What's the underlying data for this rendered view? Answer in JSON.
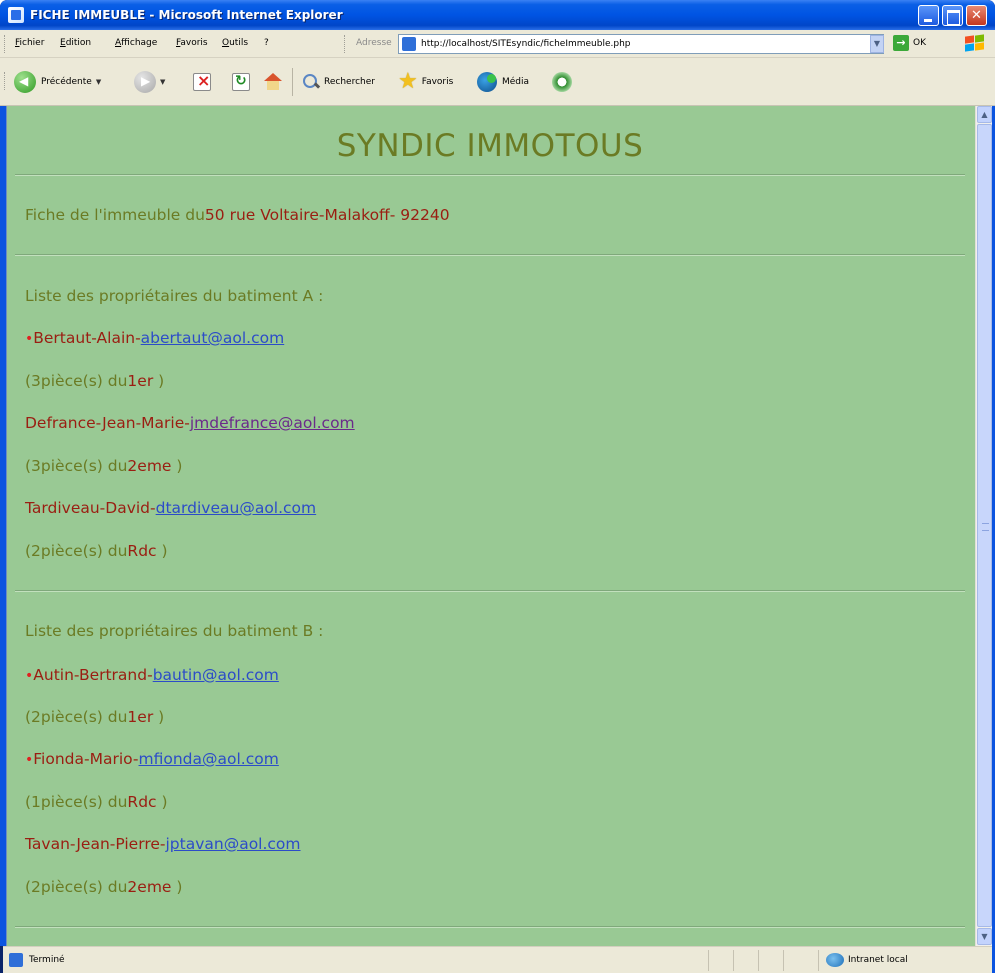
{
  "window": {
    "title": "FICHE IMMEUBLE - Microsoft Internet Explorer"
  },
  "menu": {
    "items": [
      "Fichier",
      "Edition",
      "Affichage",
      "Favoris",
      "Outils",
      "?"
    ],
    "address_label": "Adresse",
    "address_url": "http://localhost/SITEsyndic/ficheImmeuble.php",
    "go_label": "OK"
  },
  "toolbar": {
    "back_label": "Précédente",
    "search_label": "Rechercher",
    "favorites_label": "Favoris",
    "media_label": "Média"
  },
  "page": {
    "site_title": "SYNDIC IMMOTOUS",
    "fiche_prefix": "Fiche de l'immeuble du",
    "fiche_address": "50 rue Voltaire-Malakoff- 92240",
    "buildings": [
      {
        "heading": "Liste des propriétaires du batiment A :",
        "owners": [
          {
            "bullet": "•",
            "name": "Bertaut-Alain-",
            "email": "abertaut@aol.com",
            "pieces_open": "(3pièce(s) du",
            "floor": "1er",
            "pieces_close": " )"
          },
          {
            "bullet": "",
            "name": "Defrance-Jean-Marie-",
            "email": "jmdefrance@aol.com",
            "pieces_open": "(3pièce(s) du",
            "floor": "2eme",
            "pieces_close": " )"
          },
          {
            "bullet": "",
            "name": "Tardiveau-David-",
            "email": "dtardiveau@aol.com",
            "pieces_open": "(2pièce(s) du",
            "floor": "Rdc",
            "pieces_close": " )"
          }
        ]
      },
      {
        "heading": "Liste des propriétaires du batiment B :",
        "owners": [
          {
            "bullet": "•",
            "name": "Autin-Bertrand-",
            "email": "bautin@aol.com",
            "pieces_open": "(2pièce(s) du",
            "floor": "1er",
            "pieces_close": " )"
          },
          {
            "bullet": "•",
            "name": "Fionda-Mario-",
            "email": "mfionda@aol.com",
            "pieces_open": "(1pièce(s) du",
            "floor": "Rdc",
            "pieces_close": " )"
          },
          {
            "bullet": "",
            "name": "Tavan-Jean-Pierre-",
            "email": "jptavan@aol.com",
            "pieces_open": "(2pièce(s) du",
            "floor": "2eme",
            "pieces_close": " )"
          }
        ]
      }
    ]
  },
  "status": {
    "text": "Terminé",
    "zone": "Intranet local"
  },
  "colors": {
    "page_background": "#99c994",
    "olive_text": "#6b7b24",
    "dark_red_text": "#9a1e12",
    "link": "#2c4cc8",
    "visited_link": "#6b2a8a"
  }
}
